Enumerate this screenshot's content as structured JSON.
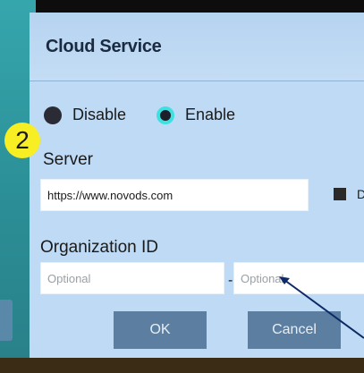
{
  "dialog": {
    "title": "Cloud Service",
    "mode": {
      "disable_label": "Disable",
      "enable_label": "Enable",
      "selected": "Enable"
    },
    "server": {
      "label": "Server",
      "value": "https://www.novods.com",
      "checkbox_label": "D"
    },
    "organization": {
      "label": "Organization ID",
      "field1_placeholder": "Optional",
      "separator": "-",
      "field2_placeholder": "Optional"
    },
    "buttons": {
      "ok_label": "OK",
      "cancel_label": "Cancel"
    }
  },
  "annotation": {
    "step_number": "2",
    "badge_color": "#f7ee23",
    "arrow_color": "#0e2a66"
  },
  "colors": {
    "dialog_bg": "#bfdaf4",
    "button_bg": "#5c7fa1",
    "radio_selected": "#3fe0e0"
  }
}
